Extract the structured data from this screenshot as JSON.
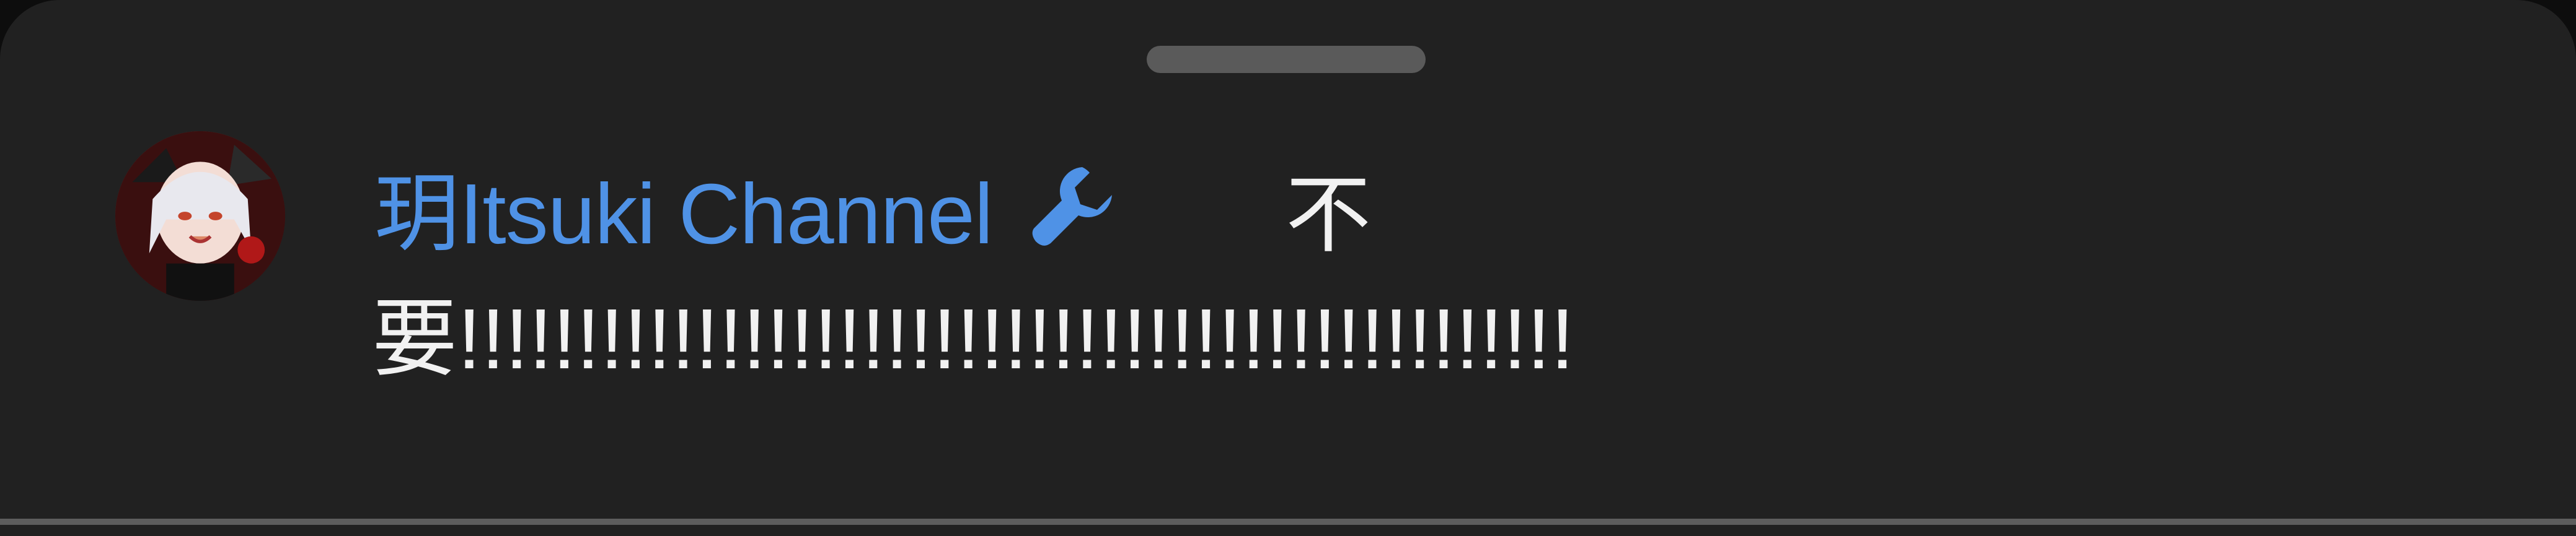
{
  "author": {
    "name": "玥Itsuki Channel",
    "badge_icon": "wrench-icon",
    "name_color": "#4f92e6"
  },
  "comment": {
    "text": "不要!!!!!!!!!!!!!!!!!!!!!!!!!!!!!!!!!!!!!!!!!!!!!!!"
  },
  "theme": {
    "background": "#212121",
    "text_color": "#f1f1f1"
  }
}
